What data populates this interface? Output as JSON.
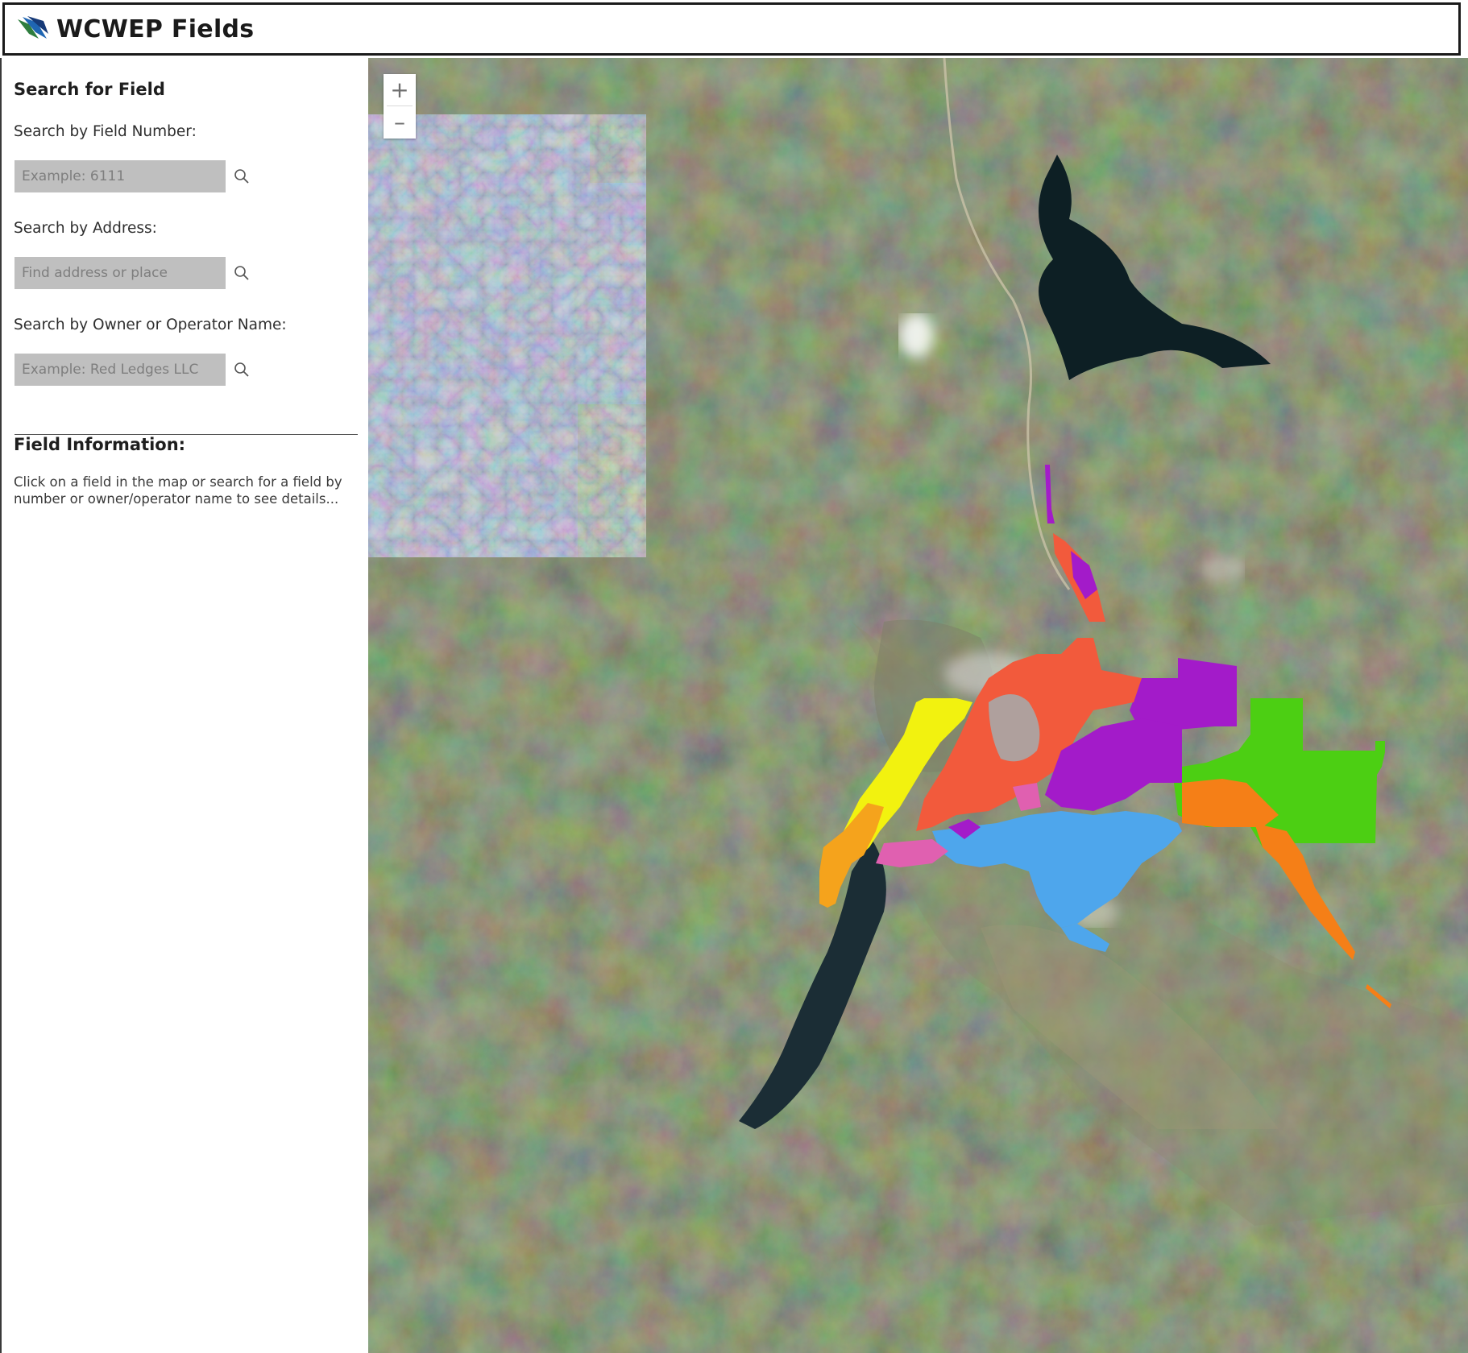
{
  "header": {
    "title": "WCWEP Fields",
    "logo_icon": "wcwep-logo-icon"
  },
  "sidebar": {
    "search_heading": "Search for Field",
    "field_number": {
      "label": "Search by Field Number:",
      "placeholder": "Example: 6111",
      "value": ""
    },
    "address": {
      "label": "Search by Address:",
      "placeholder": "Find address or place",
      "value": ""
    },
    "owner": {
      "label": "Search by Owner or Operator Name:",
      "placeholder": "Example: Red Ledges LLC",
      "value": ""
    },
    "search_icon": "search-icon",
    "info_heading": "Field Information:",
    "info_text": "Click on a field in the map or search for a field by number or owner/operator name to see details..."
  },
  "map": {
    "basemap": "satellite imagery",
    "zoom_in_label": "+",
    "zoom_out_label": "–",
    "field_colors": {
      "orange": "#f5a31c",
      "yellow": "#f2f20f",
      "red": "#f25a3c",
      "purple": "#a31bc9",
      "green": "#4ccf13",
      "dark_orange": "#f57f17",
      "blue": "#4ea6ec",
      "pink": "#e060b0",
      "gray": "#a7a7a7"
    }
  }
}
